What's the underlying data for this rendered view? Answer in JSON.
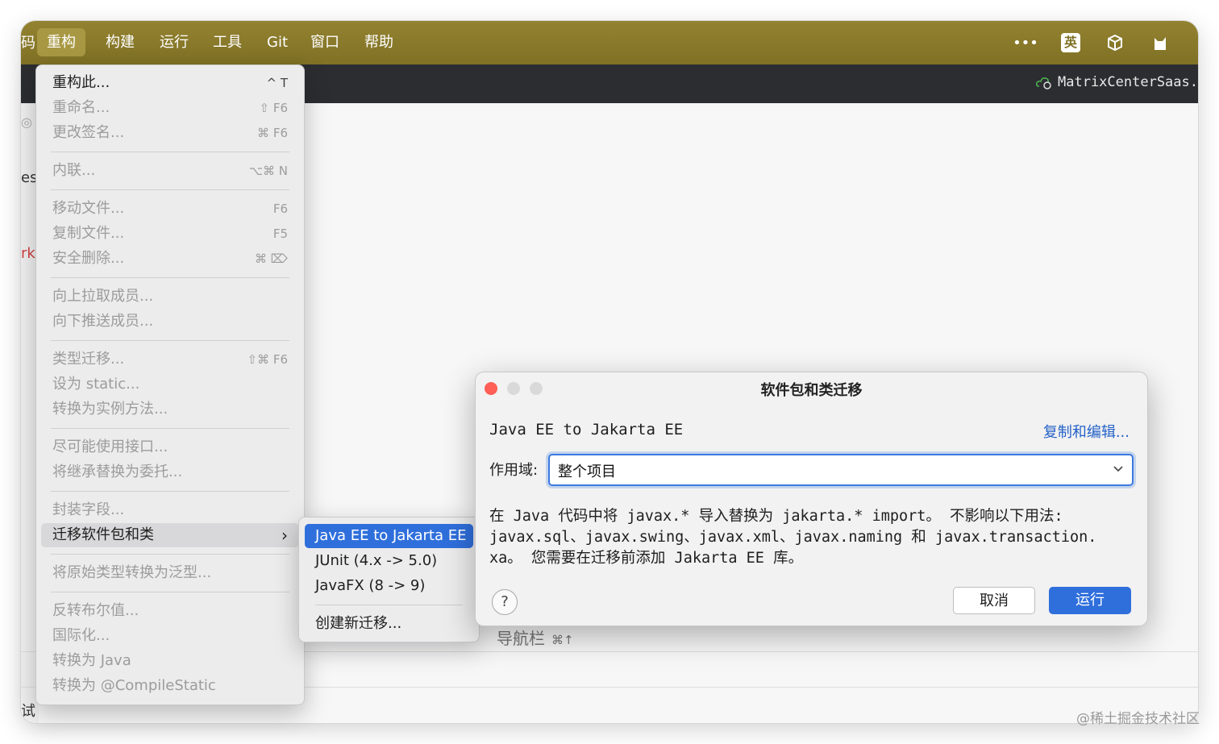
{
  "menubar": {
    "cut_left": "码",
    "items": [
      "重构",
      "构建",
      "运行",
      "工具",
      "Git",
      "窗口",
      "帮助"
    ],
    "ime": "英"
  },
  "toolbar": {
    "project": "MatrixCenterSaas."
  },
  "leftstrip": {
    "frag1": "es",
    "frag2": "rk",
    "frag3": "试器"
  },
  "refactor_menu": {
    "items": [
      {
        "label": "重构此...",
        "shortcut": "^ T"
      },
      {
        "label": "重命名...",
        "shortcut": "⇧ F6"
      },
      {
        "label": "更改签名...",
        "shortcut": "⌘ F6"
      },
      {
        "label": "内联...",
        "shortcut": "⌥⌘ N"
      },
      {
        "label": "移动文件...",
        "shortcut": "F6"
      },
      {
        "label": "复制文件...",
        "shortcut": "F5"
      },
      {
        "label": "安全删除...",
        "shortcut": "⌘ ⌦"
      },
      {
        "label": "向上拉取成员...",
        "shortcut": ""
      },
      {
        "label": "向下推送成员...",
        "shortcut": ""
      },
      {
        "label": "类型迁移...",
        "shortcut": "⇧⌘ F6"
      },
      {
        "label": "设为 static...",
        "shortcut": ""
      },
      {
        "label": "转换为实例方法...",
        "shortcut": ""
      },
      {
        "label": "尽可能使用接口...",
        "shortcut": ""
      },
      {
        "label": "将继承替换为委托...",
        "shortcut": ""
      },
      {
        "label": "封装字段...",
        "shortcut": ""
      },
      {
        "label": "迁移软件包和类",
        "shortcut": "›"
      },
      {
        "label": "将原始类型转换为泛型...",
        "shortcut": ""
      },
      {
        "label": "反转布尔值...",
        "shortcut": ""
      },
      {
        "label": "国际化...",
        "shortcut": ""
      },
      {
        "label": "转换为 Java",
        "shortcut": ""
      },
      {
        "label": "转换为 @CompileStatic",
        "shortcut": ""
      }
    ]
  },
  "migrate_submenu": {
    "items": [
      "Java EE to Jakarta EE",
      "JUnit (4.x -> 5.0)",
      "JavaFX (8 -> 9)",
      "创建新迁移..."
    ]
  },
  "dialog": {
    "title": "软件包和类迁移",
    "migration_name": "Java EE to Jakarta EE",
    "copy_edit_link": "复制和编辑...",
    "scope_label": "作用域:",
    "scope_value": "整个项目",
    "description_line1": "在 Java 代码中将 javax.* 导入替换为 jakarta.* import。 不影响以下用法:",
    "description_line2": "javax.sql、javax.swing、javax.xml、javax.naming 和 javax.transaction.",
    "description_line3": "xa。 您需要在迁移前添加 Jakarta EE 库。",
    "help": "?",
    "cancel_label": "取消",
    "run_label": "运行"
  },
  "background": {
    "nav_label": "导航栏",
    "nav_shortcut": "⌘↑"
  },
  "watermark": "@稀土掘金技术社区",
  "colors": {
    "menubar": "#8a7a2a",
    "accent": "#2f6fdc",
    "close": "#ff5f57",
    "link": "#2461c8"
  }
}
